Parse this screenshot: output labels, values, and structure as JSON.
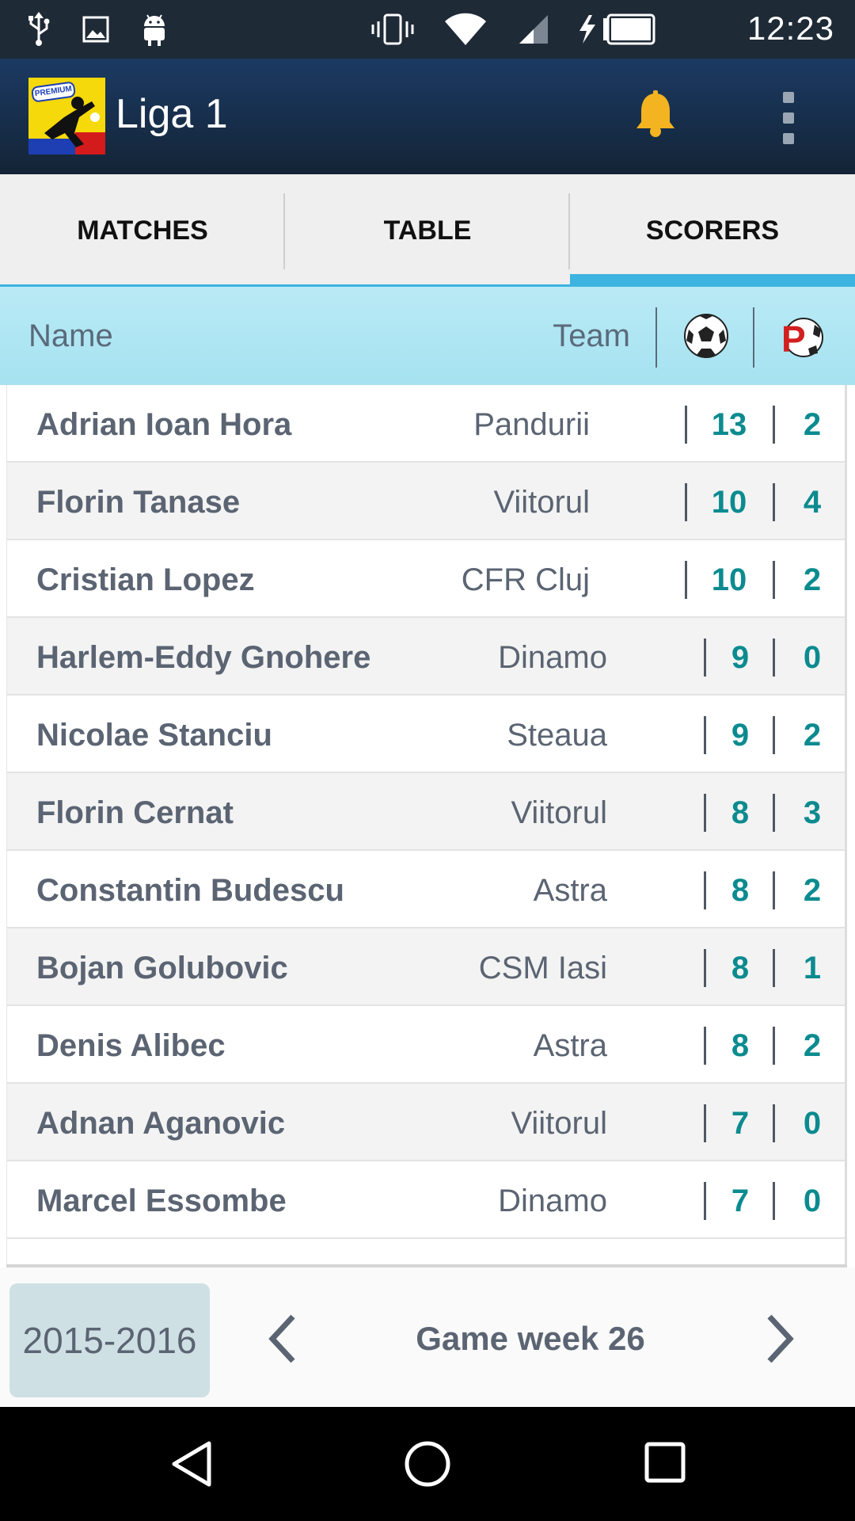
{
  "status_bar": {
    "time": "12:23",
    "left_icons": [
      "usb-icon",
      "image-icon",
      "android-icon"
    ],
    "right_icons": [
      "vibrate-icon",
      "wifi-icon",
      "signal-icon",
      "battery-charging-icon"
    ]
  },
  "app_bar": {
    "title": "Liga 1",
    "logo_badge": "PREMIUM",
    "actions": [
      "bell-icon",
      "overflow-menu-icon"
    ]
  },
  "tabs": [
    {
      "label": "MATCHES",
      "active": false
    },
    {
      "label": "TABLE",
      "active": false
    },
    {
      "label": "SCORERS",
      "active": true
    }
  ],
  "header": {
    "name": "Name",
    "team": "Team",
    "goals_icon": "soccer-ball-icon",
    "penalties_icon": "penalty-icon"
  },
  "scorers": [
    {
      "name": "Adrian Ioan Hora",
      "team": "Pandurii",
      "goals": "13",
      "penalties": "2"
    },
    {
      "name": "Florin Tanase",
      "team": "Viitorul",
      "goals": "10",
      "penalties": "4"
    },
    {
      "name": "Cristian Lopez",
      "team": "CFR Cluj",
      "goals": "10",
      "penalties": "2"
    },
    {
      "name": "Harlem-Eddy Gnohere",
      "team": "Dinamo",
      "goals": "9",
      "penalties": "0"
    },
    {
      "name": "Nicolae Stanciu",
      "team": "Steaua",
      "goals": "9",
      "penalties": "2"
    },
    {
      "name": "Florin Cernat",
      "team": "Viitorul",
      "goals": "8",
      "penalties": "3"
    },
    {
      "name": "Constantin Budescu",
      "team": "Astra",
      "goals": "8",
      "penalties": "2"
    },
    {
      "name": "Bojan Golubovic",
      "team": "CSM Iasi",
      "goals": "8",
      "penalties": "1"
    },
    {
      "name": "Denis Alibec",
      "team": "Astra",
      "goals": "8",
      "penalties": "2"
    },
    {
      "name": "Adnan Aganovic",
      "team": "Viitorul",
      "goals": "7",
      "penalties": "0"
    },
    {
      "name": "Marcel Essombe",
      "team": "Dinamo",
      "goals": "7",
      "penalties": "0"
    }
  ],
  "footer": {
    "season": "2015-2016",
    "week": "Game week 26"
  },
  "colors": {
    "app_bar": "#1b3a63",
    "accent": "#3cb3e0",
    "header_row": "#b9eaf5",
    "value_text": "#0b8b8f"
  }
}
